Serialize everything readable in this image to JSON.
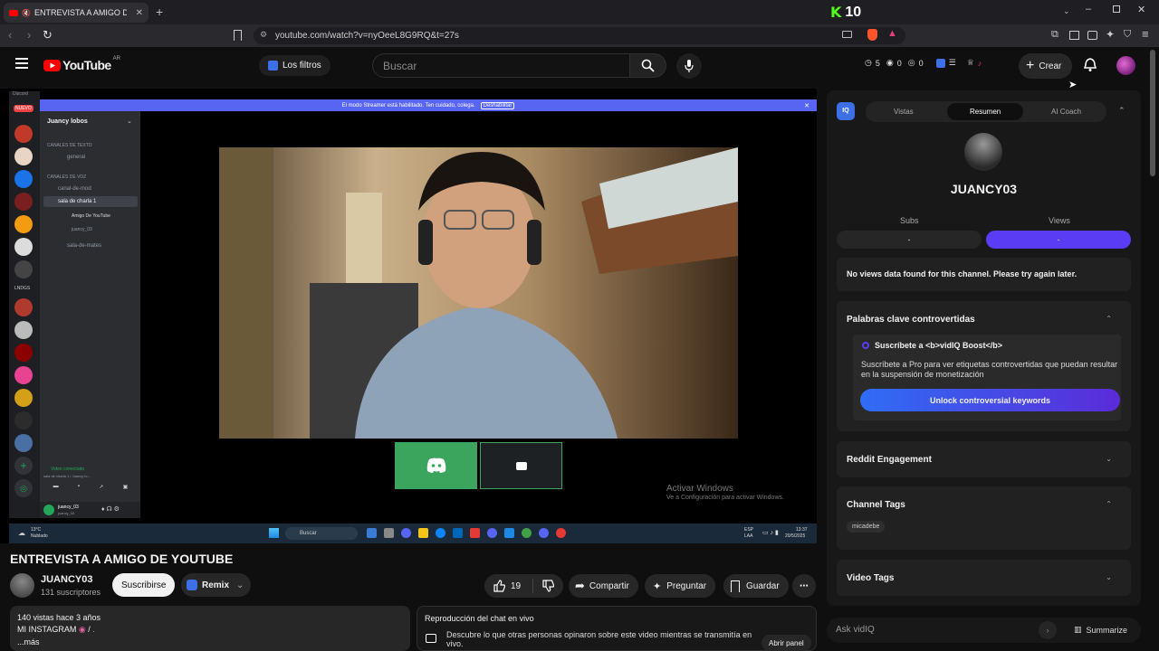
{
  "browser": {
    "tab_title": "ENTREVISTA A AMIGO DE YOUTUBE",
    "url": "youtube.com/watch?v=nyOeeL8G9RQ&t=27s",
    "ext_counter": "10"
  },
  "yt": {
    "logo_text": "YouTube",
    "region": "AR",
    "filters_label": "Los filtros",
    "search_placeholder": "Buscar",
    "create_label": "Crear",
    "stats": {
      "a": "5",
      "b": "0",
      "c": "0"
    }
  },
  "discord": {
    "server_name": "Juancy lobos",
    "streamer_banner": "El modo Streamer está habilitado. Ten cuidado, colega.",
    "streamer_disable": "Deshabilitar",
    "text_header": "CANALES DE TEXTO",
    "text_channel": "general",
    "voice_header": "CANALES DE VOZ",
    "channels": [
      "canal-de-mod",
      "sala de charla 1"
    ],
    "voice_users": [
      "Amigo De YouTube",
      "juancy_03"
    ],
    "extra_channel": "sala-de-mates",
    "connected_label": "Video conectado",
    "connected_sub": "sala de charla 1 / Juancy lo...",
    "user_name": "juancy_03",
    "user_sub": "juancy_03",
    "new_badge": "NUEVO",
    "lndgs": "LNDGS"
  },
  "windows": {
    "activate_title": "Activar Windows",
    "activate_sub": "Ve a Configuración para activar Windows.",
    "weather_temp": "13°C",
    "weather_desc": "Nublado",
    "search": "Buscar",
    "lang": "ESP",
    "lang2": "LAA",
    "time": "13:37",
    "date": "20/5/2025"
  },
  "video": {
    "title": "ENTREVISTA A AMIGO DE YOUTUBE",
    "channel": "JUANCY03",
    "subs": "131 suscriptores",
    "subscribe": "Suscribirse",
    "remix": "Remix",
    "likes": "19",
    "share": "Compartir",
    "ask": "Preguntar",
    "save": "Guardar",
    "desc_views": "140 vistas  hace 3 años",
    "desc_text": "MI INSTAGRAM",
    "desc_more": "...más",
    "chat_title": "Reproducción del chat en vivo",
    "chat_text": "Descubre lo que otras personas opinaron sobre este video mientras se transmitía en vivo.",
    "chat_btn": "Abrir panel"
  },
  "vidiq": {
    "tabs": [
      "Vistas",
      "Resumen",
      "AI Coach"
    ],
    "channel_name": "JUANCY03",
    "subs_label": "Subs",
    "views_label": "Views",
    "subs_value": "-",
    "views_value": "-",
    "no_data": "No views data found for this channel. Please try again later.",
    "controversial_title": "Palabras clave controvertidas",
    "boost_title": "Suscríbete a <b>vidIQ Boost</b>",
    "boost_text": "Suscríbete a Pro para ver etiquetas controvertidas que puedan resultar en la suspensión de monetización",
    "unlock_btn": "Unlock controversial keywords",
    "reddit": "Reddit Engagement",
    "channel_tags": "Channel Tags",
    "tag": "micadebe",
    "video_tags": "Video Tags",
    "ask_placeholder": "Ask vidIQ",
    "summarize": "Summarize",
    "accent": "#5b3cf5"
  }
}
